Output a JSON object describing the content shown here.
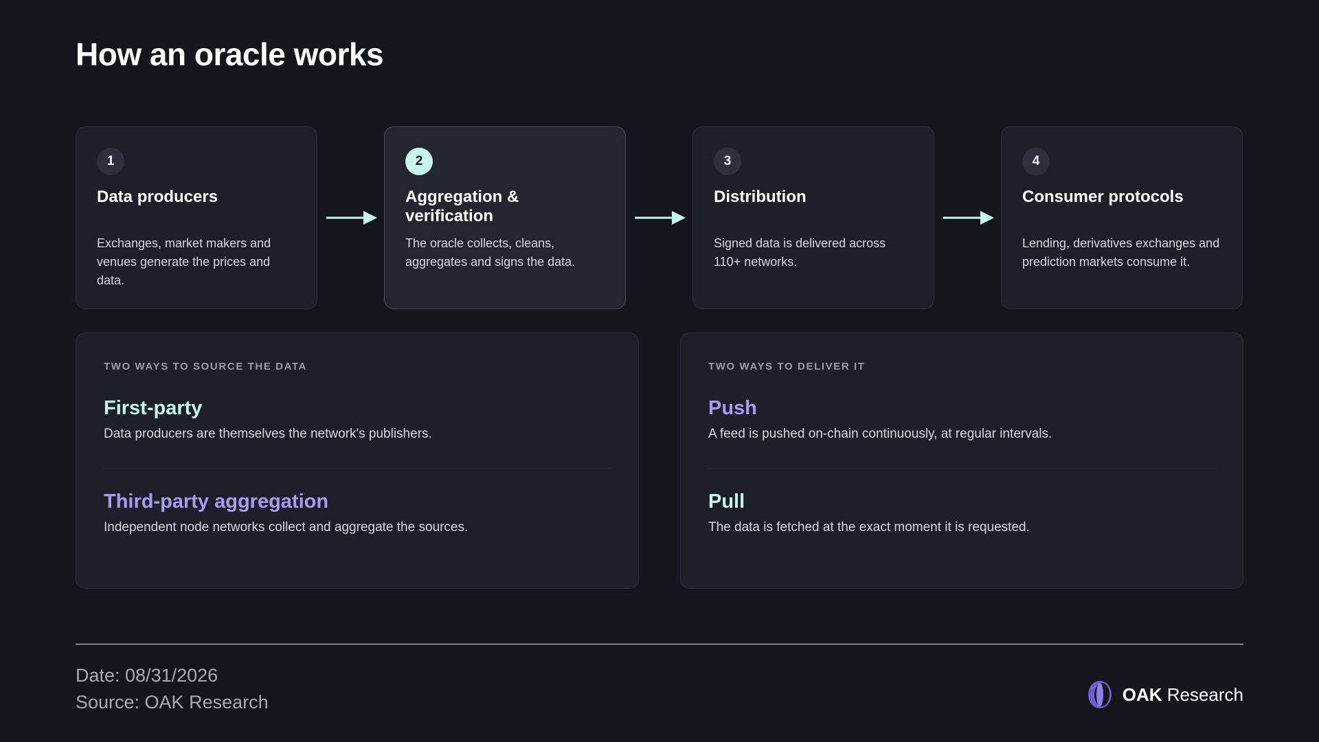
{
  "title": "How an oracle works",
  "steps": [
    {
      "number": "1",
      "title": "Data producers",
      "description": "Exchanges, market makers and venues generate the prices and data."
    },
    {
      "number": "2",
      "title": "Aggregation & verification",
      "description": "The oracle collects, cleans, aggregates and signs the data."
    },
    {
      "number": "3",
      "title": "Distribution",
      "description": "Signed data is delivered across 110+ networks."
    },
    {
      "number": "4",
      "title": "Consumer protocols",
      "description": "Lending, derivatives exchanges and prediction markets consume it."
    }
  ],
  "source_panel": {
    "label": "TWO WAYS TO SOURCE THE DATA",
    "options": [
      {
        "title": "First-party",
        "description": "Data producers are themselves the network's publishers."
      },
      {
        "title": "Third-party aggregation",
        "description": "Independent node networks collect and aggregate the sources."
      }
    ]
  },
  "deliver_panel": {
    "label": "TWO WAYS TO DELIVER IT",
    "options": [
      {
        "title": "Push",
        "description": "A feed is pushed on-chain continuously, at regular intervals."
      },
      {
        "title": "Pull",
        "description": "The data is fetched at the exact moment it is requested."
      }
    ]
  },
  "footer": {
    "date": "Date: 08/31/2026",
    "source": "Source: OAK Research",
    "brand_bold": "OAK",
    "brand_rest": " Research"
  },
  "colors": {
    "background": "#15161c",
    "card": "#1e2029",
    "accent_mint": "#c9f6ea",
    "accent_purple": "#a99bf0"
  },
  "active_step": "2"
}
